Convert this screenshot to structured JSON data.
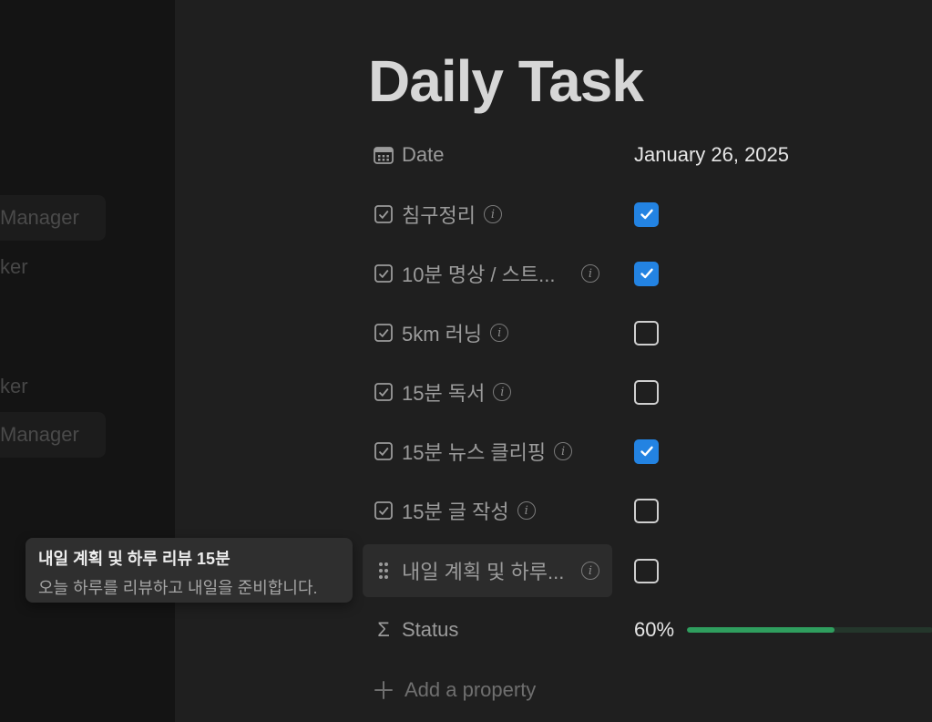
{
  "sidebar": {
    "items": [
      {
        "label": "Manager"
      },
      {
        "label": "ker"
      },
      {
        "label": "ker"
      },
      {
        "label": "Manager"
      }
    ]
  },
  "page": {
    "title": "Daily Task"
  },
  "properties": [
    {
      "label": "Date",
      "icon": "calendar-icon",
      "value": "January 26, 2025"
    },
    {
      "label": "침구정리",
      "icon": "checkbox-property-icon",
      "checked": true
    },
    {
      "label": "10분 명상 / 스트...",
      "icon": "checkbox-property-icon",
      "checked": true
    },
    {
      "label": "5km 러닝",
      "icon": "checkbox-property-icon",
      "checked": false
    },
    {
      "label": "15분 독서",
      "icon": "checkbox-property-icon",
      "checked": false
    },
    {
      "label": "15분 뉴스 클리핑",
      "icon": "checkbox-property-icon",
      "checked": true
    },
    {
      "label": "15분 글 작성",
      "icon": "checkbox-property-icon",
      "checked": false
    },
    {
      "label": "내일 계획 및 하루...",
      "icon": "drag-handle-icon",
      "checked": false
    },
    {
      "label": "Status",
      "icon": "sigma-icon",
      "value": "60%",
      "progress": 0.6
    }
  ],
  "add_property": {
    "label": "Add a property"
  },
  "tooltip": {
    "title": "내일 계획 및 하루 리뷰 15분",
    "description": "오늘 하루를 리뷰하고 내일을 준비합니다."
  },
  "colors": {
    "accent": "#2383e2",
    "progress": "#2f9e5e"
  }
}
